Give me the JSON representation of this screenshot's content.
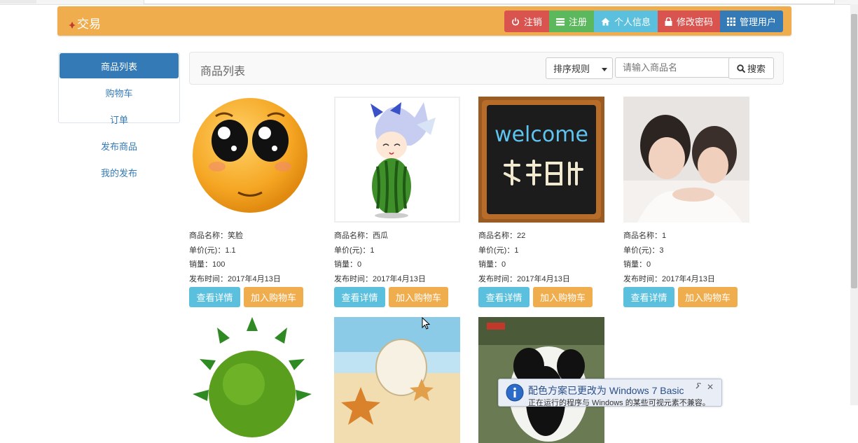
{
  "app": {
    "brand": "交易"
  },
  "nav": {
    "buttons": [
      {
        "label": "注销",
        "icon": "power-icon"
      },
      {
        "label": "注册",
        "icon": "list-icon"
      },
      {
        "label": "个人信息",
        "icon": "home-icon"
      },
      {
        "label": "修改密码",
        "icon": "lock-icon"
      },
      {
        "label": "管理用户",
        "icon": "grid-icon"
      }
    ]
  },
  "sidebar": {
    "items": [
      {
        "label": "商品列表",
        "active": true
      },
      {
        "label": "购物车"
      },
      {
        "label": "订单"
      },
      {
        "label": "发布商品"
      },
      {
        "label": "我的发布"
      }
    ]
  },
  "panel": {
    "title": "商品列表",
    "sort_label": "排序规则",
    "search_placeholder": "请输入商品名",
    "search_label": "搜索"
  },
  "products": [
    {
      "name": "商品名称：笑脸",
      "price": "单价(元)：1.1",
      "sales": "销量：100",
      "date": "发布时间：2017年4月13日",
      "image": "smiley-face"
    },
    {
      "name": "商品名称：西瓜",
      "price": "单价(元)：1",
      "sales": "销量：0",
      "date": "发布时间：2017年4月13日",
      "image": "anime-girl-watermelon"
    },
    {
      "name": "商品名称：22",
      "price": "单价(元)：1",
      "sales": "销量：0",
      "date": "发布时间：2017年4月13日",
      "image": "welcome-chalkboard"
    },
    {
      "name": "商品名称：1",
      "price": "单价(元)：3",
      "sales": "销量：0",
      "date": "发布时间：2017年4月13日",
      "image": "two-children-photo"
    },
    {
      "image": "green-planet-trees"
    },
    {
      "image": "beach-starfish"
    },
    {
      "image": "panda"
    }
  ],
  "card_buttons": {
    "detail": "查看详情",
    "add_cart": "加入购物车"
  },
  "notification": {
    "title": "配色方案已更改为 Windows 7 Basic",
    "subtitle": "正在运行的程序与 Windows 的某些可视元素不兼容。"
  },
  "colors": {
    "warning": "#f0ad4e",
    "danger": "#d9534f",
    "success": "#5cb85c",
    "info": "#5bc0de",
    "primary": "#337ab7"
  }
}
